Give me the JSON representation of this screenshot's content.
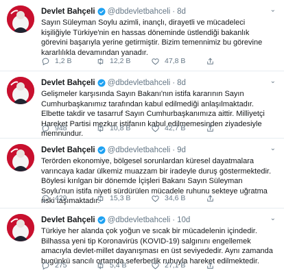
{
  "account": {
    "name": "Devlet Bahçeli",
    "handle": "@dbdevletbahceli",
    "accent_color": "#1da1f2",
    "avatar_color": "#c8102e"
  },
  "tweets": [
    {
      "time": "8d",
      "text": "Sayın Süleyman Soylu azimli, inançlı, dirayetli ve mücadeleci kişiliğiyle Türkiye'nin en hassas döneminde üstlendiği bakanlık görevini başarıyla yerine getirmiştir. Bizim temennimiz bu görevine kararlılıkla devamından yanadır.",
      "replies": "1,2 B",
      "retweets": "12,2 B",
      "likes": "47,8 B"
    },
    {
      "time": "8d",
      "text": "Gelişmeler karşısında Sayın Bakanı'nın istifa kararının Sayın Cumhurbaşkanımız tarafından kabul edilmediği anlaşılmaktadır. Elbette takdir ve tasarruf Sayın Cumhurbaşkanımıza aittir. Milliyetçi Hareket Partisi mezkur istifanın kabul edilmemesinden ziyadesiyle memnundur.",
      "replies": "948",
      "retweets": "10,8 B",
      "likes": "42,7 B"
    },
    {
      "time": "9d",
      "text": "Terörden ekonomiye, bölgesel sorunlardan küresel dayatmalara varıncaya kadar ülkemiz muazzam bir iradeyle duruş göstermektedir. Böylesi kırılgan bir dönemde İçişleri Bakanı Sayın Süleyman Soylu'nun istifa niyeti sürdürülen mücadele ruhunu sekteye uğratma riski taşımaktadır.",
      "replies": "429",
      "retweets": "15,3 B",
      "likes": "34,6 B"
    },
    {
      "time": "10d",
      "text": "Türkiye her alanda çok yoğun ve sıcak bir mücadelenin içindedir. Bilhassa yeni tip Koronavirüs (KOVID-19) salgınını engellemek amacıyla devlet-millet dayanışması en üst seviyededir. Aynı zamanda bugünkü sancılı ortamda seferberlik ruhuyla hareket edilmektedir.",
      "replies": "275",
      "retweets": "5,4 B",
      "likes": "27,1 B"
    }
  ]
}
